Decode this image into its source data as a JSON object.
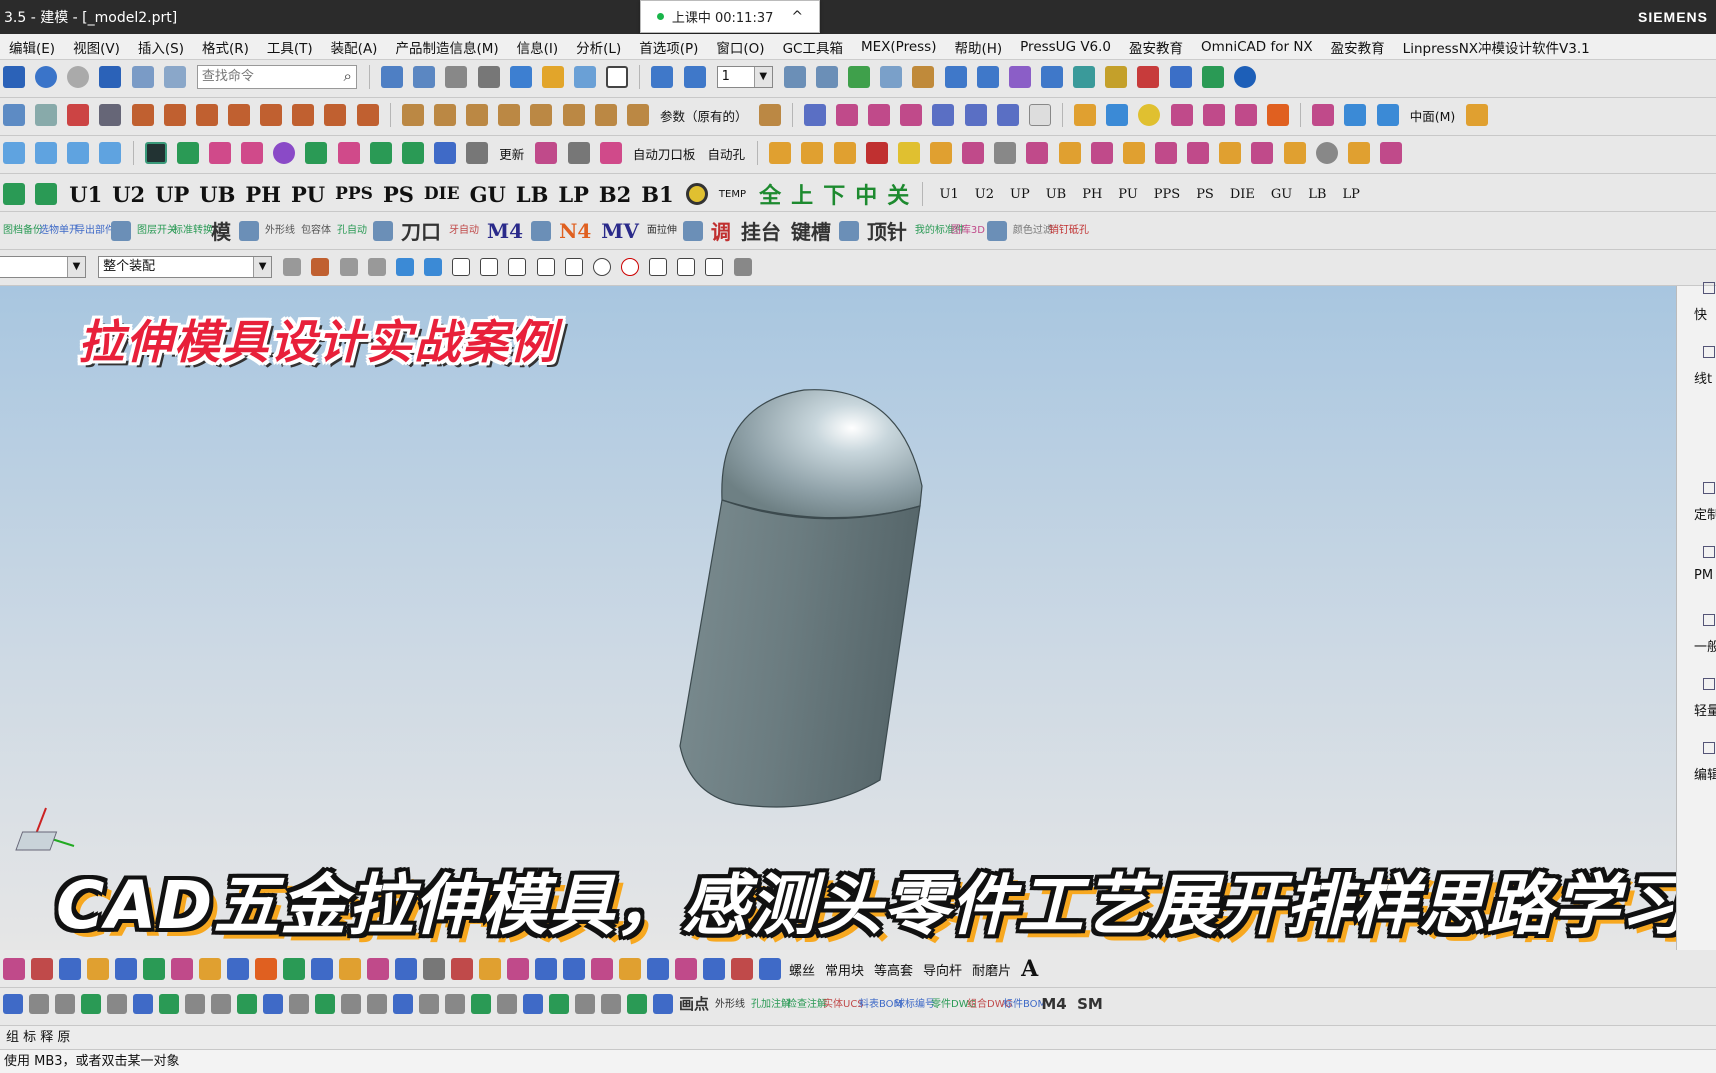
{
  "window": {
    "title": "3.5 - 建模 - [_model2.prt]",
    "brand": "SIEMENS"
  },
  "timer": {
    "label": "上课中 00:11:37"
  },
  "menu": [
    "编辑(E)",
    "视图(V)",
    "插入(S)",
    "格式(R)",
    "工具(T)",
    "装配(A)",
    "产品制造信息(M)",
    "信息(I)",
    "分析(L)",
    "首选项(P)",
    "窗口(O)",
    "GC工具箱",
    "MEX(Press)",
    "帮助(H)",
    "PressUG V6.0",
    "盈安教育",
    "OmniCAD for NX",
    "盈安教育",
    "LinpressNX冲模设计软件V3.1"
  ],
  "toolbar": {
    "search_placeholder": "查找命令",
    "layer_value": "1",
    "param_label": "参数（原有的）",
    "middle_label": "中面(M)",
    "auto_blade": "自动刀口板",
    "auto_hole": "自动孔",
    "update": "更新",
    "row4_text_buttons": [
      "U1",
      "U2",
      "UP",
      "UB",
      "PH",
      "PU",
      "PPS",
      "PS",
      "DIE",
      "GU",
      "LB",
      "LP",
      "B2",
      "B1"
    ],
    "row4_cn_buttons": [
      "全",
      "上",
      "下",
      "中",
      "关"
    ],
    "row4_right": [
      "U1",
      "U2",
      "UP",
      "UB",
      "PH",
      "PU",
      "PPS",
      "PS",
      "DIE",
      "GU",
      "LB",
      "LP"
    ],
    "row5_labels": [
      "图档备份",
      "选物单开",
      "导出部件",
      "图层开关",
      "标准转换",
      "模",
      "外形线",
      "包容体",
      "孔自动",
      "刀口",
      "牙自动",
      "M4",
      "N4",
      "MV",
      "面拉伸",
      "调",
      "挂台",
      "键槽",
      "顶针",
      "我的标准件",
      "图库3D",
      "颜色过滤",
      "销钉砥孔"
    ],
    "filter_value": "整个装配",
    "selection_value": ""
  },
  "right_panel": [
    "快",
    "线t",
    "定制",
    "PM",
    "一般",
    "轻量绘",
    "编辑"
  ],
  "overlay": {
    "title": "拉伸模具设计实战案例",
    "subtitle": "CAD五金拉伸模具，感测头零件工艺展开排样思路学习"
  },
  "bottom": {
    "row1_labels": [
      "螺丝",
      "常用块",
      "等高套",
      "导向杆",
      "耐磨片"
    ],
    "row2_labels": [
      "画点",
      "外形线",
      "孔加注解",
      "检查注解",
      "实体UCS",
      "料表BOM",
      "球标编号",
      "零件DWG",
      "组合DWG",
      "标件BOM",
      "M4",
      "SM"
    ],
    "row3": "组 标 释 原",
    "status": "使用 MB3，或者双击某一对象"
  },
  "colors": {
    "accent": "#e8203a",
    "subtitle_shadow": "#f7a820",
    "model": "#6e8084"
  }
}
